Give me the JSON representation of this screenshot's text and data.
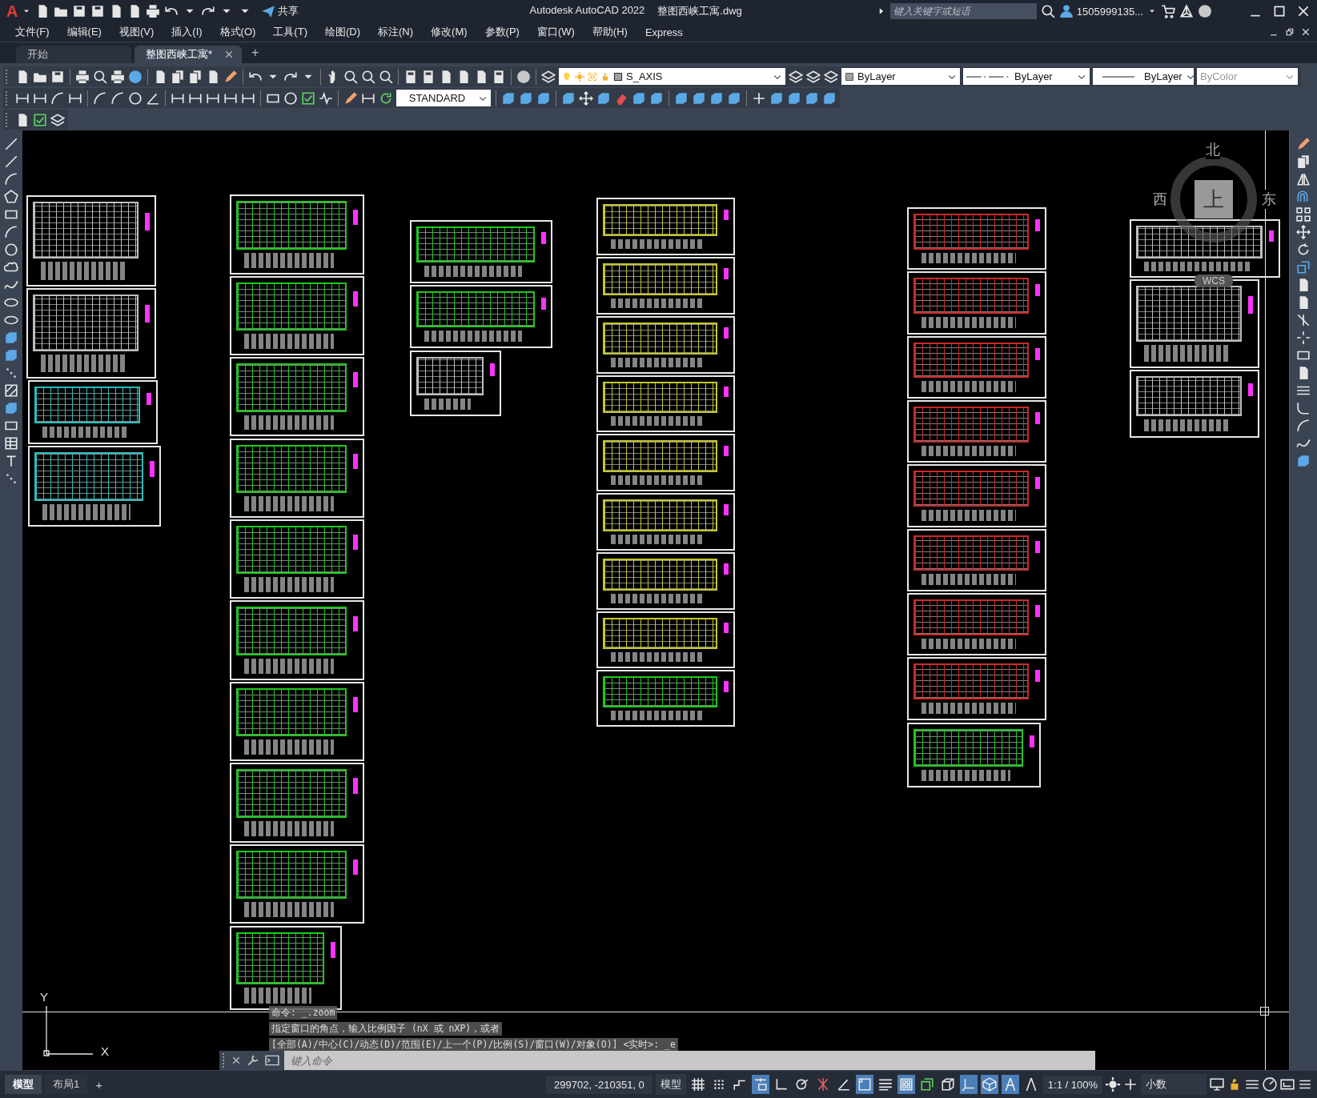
{
  "app_button": {
    "label": "A"
  },
  "quick_access": {
    "share": "共享"
  },
  "title": {
    "app": "Autodesk AutoCAD 2022",
    "file": "整图西峡工寓.dwg"
  },
  "search": {
    "placeholder": "键入关键字或短语"
  },
  "account": {
    "user": "1505999135..."
  },
  "menu": [
    "文件(F)",
    "编辑(E)",
    "视图(V)",
    "插入(I)",
    "格式(O)",
    "工具(T)",
    "绘图(D)",
    "标注(N)",
    "修改(M)",
    "参数(P)",
    "窗口(W)",
    "帮助(H)",
    "Express"
  ],
  "tabs": [
    {
      "label": "开始",
      "selected": false
    },
    {
      "label": "整图西峡工寓*",
      "selected": true
    }
  ],
  "new_tab": "+",
  "properties_toolbar": {
    "layer": "S_AXIS",
    "text_style": "STANDARD",
    "color_control": "ByLayer",
    "linetype": "ByLayer",
    "lineweight": "ByLayer",
    "plot_style": {
      "value": "ByColor",
      "disabled": true
    }
  },
  "viewcube": {
    "north": "北",
    "west": "西",
    "east": "东",
    "face": "上",
    "wcs": "WCS"
  },
  "ucs_icon": {
    "y": "Y",
    "x": "X"
  },
  "command": {
    "history": [
      "命令:  _.zoom",
      "指定窗口的角点，输入比例因子 (nX 或 nXP)，或者",
      "[全部(A)/中心(C)/动态(D)/范围(E)/上一个(P)/比例(S)/窗口(W)/对象(O)] <实时>: _e"
    ],
    "placeholder": "键入命令"
  },
  "layout_tabs": [
    {
      "label": "模型",
      "selected": true
    },
    {
      "label": "布局1",
      "selected": false
    }
  ],
  "add_layout": "+",
  "status_bar": {
    "coordinates": "299702, -210351, 0",
    "space": "模型",
    "annotation_scale": "1:1 / 100%",
    "units": "小数"
  },
  "status_toggles": [
    {
      "kind": "grid",
      "on": false
    },
    {
      "kind": "dots",
      "on": false
    },
    {
      "kind": "infer",
      "on": false
    },
    {
      "kind": "dynamic",
      "on": true
    },
    {
      "kind": "ortho",
      "on": false
    },
    {
      "kind": "polar",
      "on": false
    },
    {
      "kind": "isodraft",
      "on": false
    },
    {
      "kind": "angle",
      "on": false
    },
    {
      "kind": "osnap",
      "on": true
    },
    {
      "kind": "lineweight",
      "on": false
    },
    {
      "kind": "transparency",
      "on": true
    },
    {
      "kind": "cycling",
      "on": false
    },
    {
      "kind": "osnap3d",
      "on": false
    },
    {
      "kind": "ucs",
      "on": true
    },
    {
      "kind": "gizmo",
      "on": true
    },
    {
      "kind": "annotation",
      "on": true
    },
    {
      "kind": "autoscale",
      "on": false
    }
  ]
}
